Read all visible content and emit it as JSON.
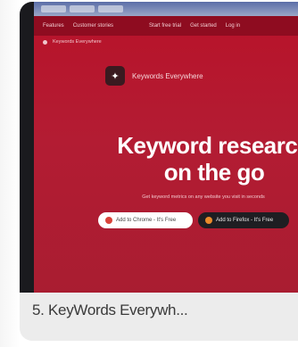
{
  "nav": {
    "items": [
      "Features",
      "Customer stories",
      "Start free trial",
      "Get started",
      "Log in"
    ],
    "sub_items": [
      "Keywords Everywhere"
    ]
  },
  "brand": {
    "name": "Keywords Everywhere"
  },
  "hero": {
    "headline_line1": "Keyword research",
    "headline_line2": "on the go",
    "subtext": "Get keyword metrics on any website you visit in seconds"
  },
  "buttons": {
    "chrome": "Add to Chrome - It's Free",
    "firefox": "Add to Firefox - It's Free"
  },
  "caption": {
    "text": "5. KeyWords Everywh..."
  },
  "colors": {
    "hero_red": "#b31c33",
    "nav_dark_red": "#8e0c20"
  }
}
